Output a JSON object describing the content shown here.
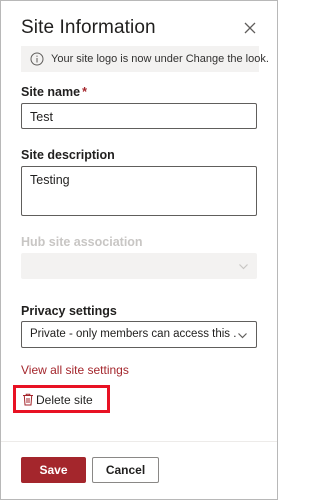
{
  "header": {
    "title": "Site Information",
    "close_icon": "close-icon"
  },
  "info_bar": {
    "icon": "info-icon",
    "message": "Your site logo is now under Change the look."
  },
  "site_name": {
    "label": "Site name",
    "required_marker": "*",
    "value": "Test"
  },
  "site_description": {
    "label": "Site description",
    "value": "Testing"
  },
  "hub_association": {
    "label": "Hub site association",
    "value": "",
    "disabled": true
  },
  "privacy": {
    "label": "Privacy settings",
    "value": "Private - only members can access this ..."
  },
  "links": {
    "view_all": "View all site settings",
    "delete_site": "Delete site"
  },
  "footer": {
    "save_label": "Save",
    "cancel_label": "Cancel"
  },
  "colors": {
    "accent": "#a4262c",
    "highlight_box": "#e81123",
    "info_bar_bg": "#f3f2f1"
  }
}
